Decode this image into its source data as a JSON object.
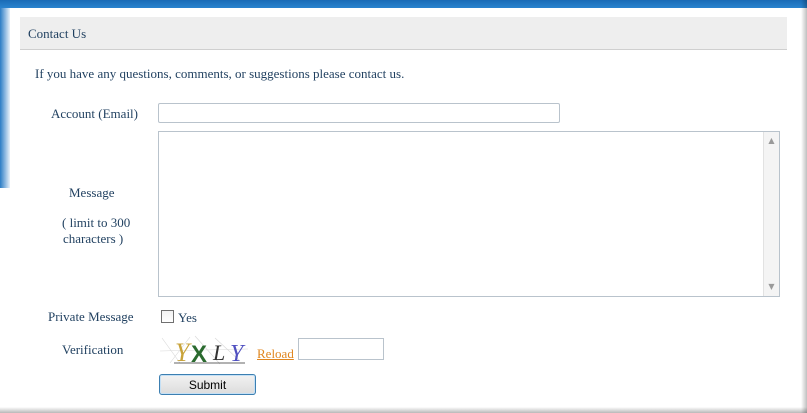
{
  "header": {
    "title": "Contact Us"
  },
  "intro": "If you have any questions, comments, or suggestions please contact us.",
  "form": {
    "account_label": "Account (Email)",
    "account_value": "",
    "message_label": "Message",
    "message_hint_line1": "( limit to 300",
    "message_hint_line2": "characters )",
    "message_value": "",
    "private_label": "Private Message",
    "private_option": "Yes",
    "private_checked": false,
    "verification_label": "Verification",
    "captcha_text": "YXLY",
    "reload_label": "Reload",
    "verification_value": "",
    "submit_label": "Submit"
  },
  "colors": {
    "text": "#1f3f5f",
    "link": "#e0861f",
    "accent": "#1a6bb6",
    "header_bg": "#eeeeee"
  }
}
